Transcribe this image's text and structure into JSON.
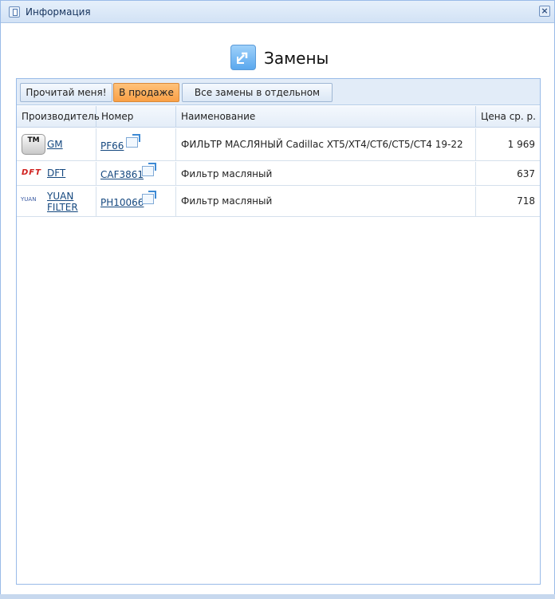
{
  "window": {
    "title": "Информация",
    "close_glyph": "×"
  },
  "heading": {
    "title": "Замены",
    "icon": "swap-arrows-icon"
  },
  "toolbar": {
    "buttons": [
      {
        "label": "Прочитай меня!",
        "active": false
      },
      {
        "label": "В продаже",
        "active": true
      },
      {
        "label": "Все замены в отдельном окне",
        "active": false
      }
    ]
  },
  "table": {
    "columns": [
      "Производитель",
      "Номер",
      "Наименование",
      "Цена ср. р."
    ],
    "rows": [
      {
        "brand": "GM",
        "brand_logo": "gm-logo",
        "logo_text": "TM",
        "number": "PF66",
        "name": "ФИЛЬТР МАСЛЯНЫЙ Cadillac XT5/XT4/CT6/CT5/CT4 19-22",
        "price": "1 969"
      },
      {
        "brand": "DFT",
        "brand_logo": "dft-logo",
        "logo_text": "DFT",
        "number": "CAF3861",
        "name": "Фильтр масляный",
        "price": "637"
      },
      {
        "brand": "YUAN FILTER",
        "brand_line1": "YUAN",
        "brand_line2": "FILTER",
        "brand_logo": "yuan-logo",
        "logo_text": "YUAN",
        "number": "PH10066",
        "name": "Фильтр масляный",
        "price": "718"
      }
    ]
  },
  "colors": {
    "accent_active": "#f9a046",
    "border": "#99bbe8"
  }
}
